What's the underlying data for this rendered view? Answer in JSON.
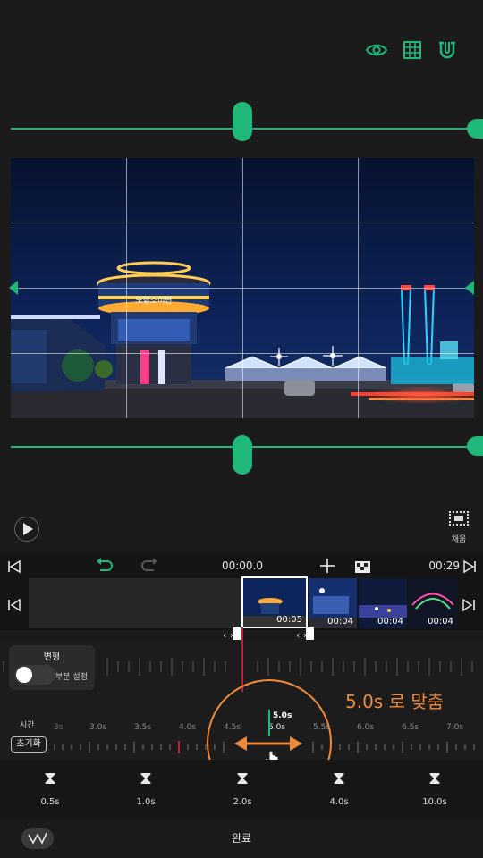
{
  "toolbar_icons": [
    "eye-icon",
    "grid-icon",
    "magnet-icon"
  ],
  "accent_color": "#1fb87a",
  "annotation_color": "#ee8a3a",
  "fill_label": "채움",
  "timeline": {
    "current_time": "00:00.0",
    "end_time": "00:29"
  },
  "clips": [
    {
      "duration": "00:05"
    },
    {
      "duration": "00:04"
    },
    {
      "duration": "00:04"
    },
    {
      "duration": "00:04"
    }
  ],
  "photo_sign_text": "모항소이란",
  "transform": {
    "title": "변형",
    "partial_label": "부분 설정"
  },
  "time_ruler": {
    "label": "시간",
    "reset_label": "초기화",
    "ticks": [
      "3s",
      "3.0s",
      "3.5s",
      "4.0s",
      "4.5s",
      "5.0s",
      "5.5s",
      "6.0s",
      "6.5s",
      "7.0s"
    ],
    "current_value": "5.0s",
    "annotation": "5.0s 로 맞춤"
  },
  "presets": [
    {
      "label": "0.5s"
    },
    {
      "label": "1.0s"
    },
    {
      "label": "2.0s"
    },
    {
      "label": "4.0s"
    },
    {
      "label": "10.0s"
    }
  ],
  "done_label": "완료"
}
